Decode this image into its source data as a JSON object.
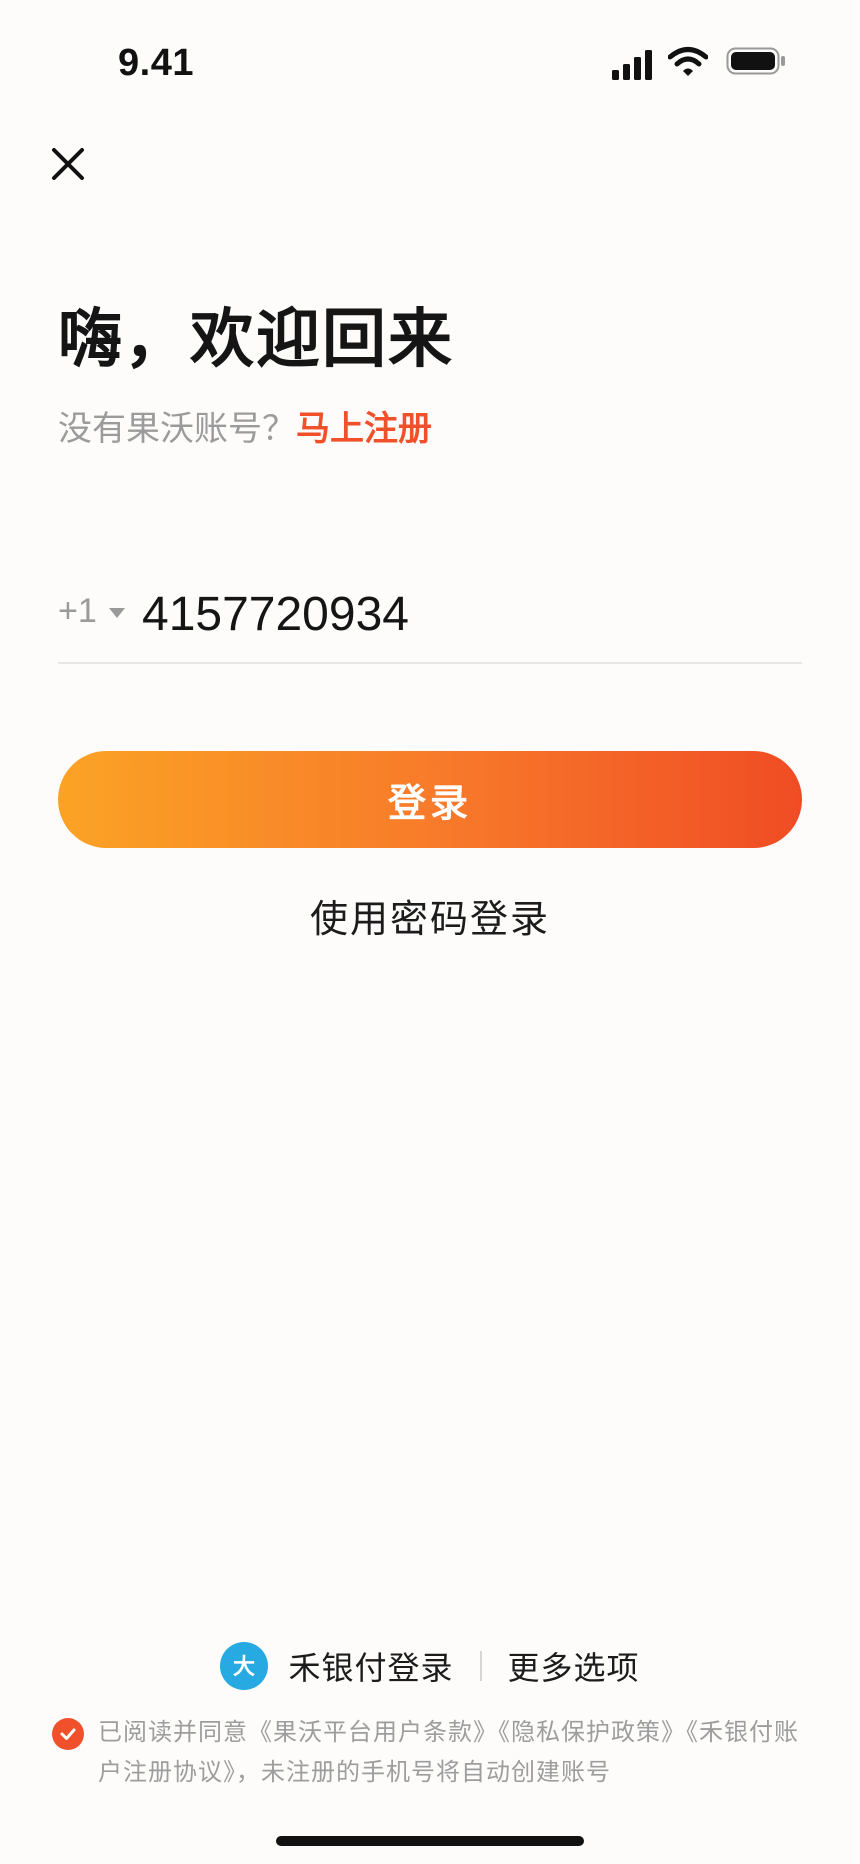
{
  "status_bar": {
    "time": "9.41",
    "icons": [
      "signal-icon",
      "wifi-icon",
      "battery-icon"
    ]
  },
  "header": {
    "close_icon": "close-icon"
  },
  "title": "嗨，欢迎回来",
  "register": {
    "prompt": "没有果沃账号？",
    "link": "马上注册"
  },
  "phone": {
    "country_code": "+1",
    "value": "4157720934"
  },
  "login_button_label": "登录",
  "password_login_label": "使用密码登录",
  "alt_login": {
    "heyinfu_label": "禾银付登录",
    "heyinfu_logo_text": "大",
    "more_label": "更多选项"
  },
  "agreement": {
    "prefix": "已阅读并同意",
    "terms": "《果沃平台用户条款》",
    "privacy": "《隐私保护政策》",
    "account_agreement": "《禾银付账户注册协议》",
    "suffix": "，未注册的手机号将自动创建账号",
    "checked": true
  },
  "colors": {
    "accent": "#f0512b",
    "gradient_start": "#fba325",
    "gradient_end": "#f04c24",
    "heyinfu_blue": "#27a9e1",
    "background": "#fdfcfb"
  }
}
